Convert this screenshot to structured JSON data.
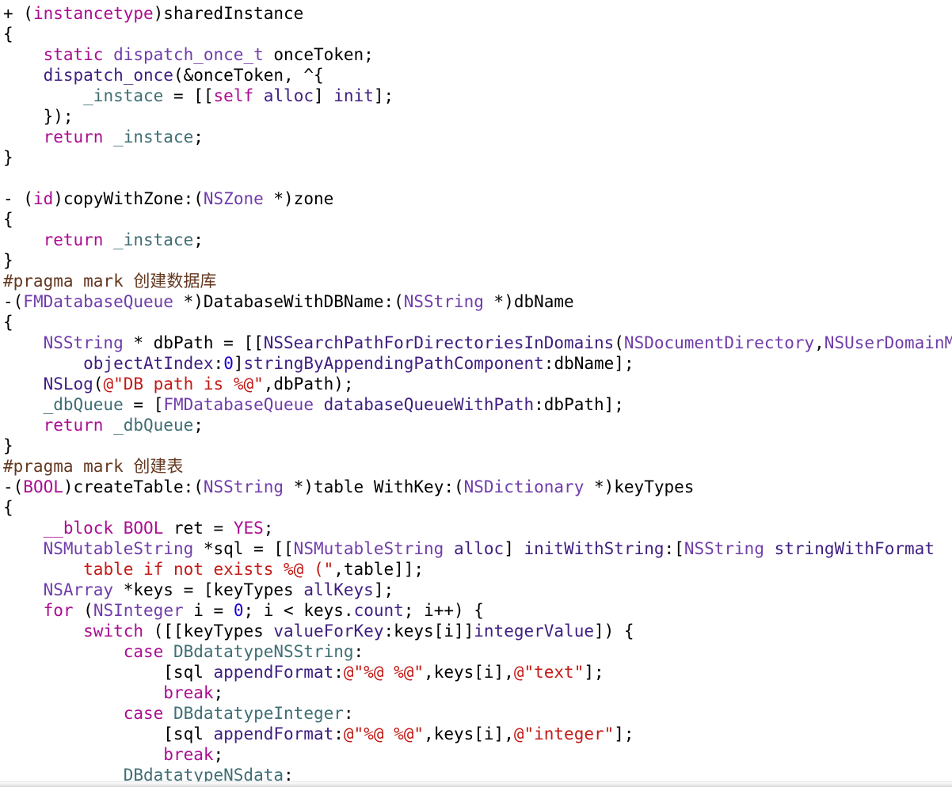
{
  "editor": {
    "lines": [
      [
        [
          "plain",
          "+ ("
        ],
        [
          "kw",
          "instancetype"
        ],
        [
          "plain",
          ")sharedInstance"
        ]
      ],
      [
        [
          "plain",
          "{"
        ]
      ],
      [
        [
          "plain",
          "    "
        ],
        [
          "kw",
          "static"
        ],
        [
          "plain",
          " "
        ],
        [
          "type",
          "dispatch_once_t"
        ],
        [
          "plain",
          " onceToken;"
        ]
      ],
      [
        [
          "plain",
          "    "
        ],
        [
          "call",
          "dispatch_once"
        ],
        [
          "plain",
          "(&onceToken, ^{"
        ]
      ],
      [
        [
          "plain",
          "        "
        ],
        [
          "var",
          "_instace"
        ],
        [
          "plain",
          " = [["
        ],
        [
          "kw",
          "self"
        ],
        [
          "plain",
          " "
        ],
        [
          "call",
          "alloc"
        ],
        [
          "plain",
          "] "
        ],
        [
          "call",
          "init"
        ],
        [
          "plain",
          "];"
        ]
      ],
      [
        [
          "plain",
          "    });"
        ]
      ],
      [
        [
          "plain",
          "    "
        ],
        [
          "kw",
          "return"
        ],
        [
          "plain",
          " "
        ],
        [
          "var",
          "_instace"
        ],
        [
          "plain",
          ";"
        ]
      ],
      [
        [
          "plain",
          "}"
        ]
      ],
      [],
      [
        [
          "plain",
          "- ("
        ],
        [
          "kw",
          "id"
        ],
        [
          "plain",
          ")copyWithZone:("
        ],
        [
          "type",
          "NSZone"
        ],
        [
          "plain",
          " *)zone"
        ]
      ],
      [
        [
          "plain",
          "{"
        ]
      ],
      [
        [
          "plain",
          "    "
        ],
        [
          "kw",
          "return"
        ],
        [
          "plain",
          " "
        ],
        [
          "var",
          "_instace"
        ],
        [
          "plain",
          ";"
        ]
      ],
      [
        [
          "plain",
          "}"
        ]
      ],
      [
        [
          "pre",
          "#pragma mark 创建数据库"
        ]
      ],
      [
        [
          "plain",
          "-("
        ],
        [
          "type",
          "FMDatabaseQueue"
        ],
        [
          "plain",
          " *)DatabaseWithDBName:("
        ],
        [
          "type",
          "NSString"
        ],
        [
          "plain",
          " *)dbName"
        ]
      ],
      [
        [
          "plain",
          "{"
        ]
      ],
      [
        [
          "plain",
          "    "
        ],
        [
          "type",
          "NSString"
        ],
        [
          "plain",
          " * dbPath = [["
        ],
        [
          "call",
          "NSSearchPathForDirectoriesInDomains"
        ],
        [
          "plain",
          "("
        ],
        [
          "type",
          "NSDocumentDirectory"
        ],
        [
          "plain",
          ","
        ],
        [
          "type",
          "NSUserDomainMask"
        ]
      ],
      [
        [
          "plain",
          "        "
        ],
        [
          "call",
          "objectAtIndex"
        ],
        [
          "plain",
          ":"
        ],
        [
          "num",
          "0"
        ],
        [
          "plain",
          "]"
        ],
        [
          "call",
          "stringByAppendingPathComponent"
        ],
        [
          "plain",
          ":dbName];"
        ]
      ],
      [
        [
          "plain",
          "    "
        ],
        [
          "call",
          "NSLog"
        ],
        [
          "plain",
          "("
        ],
        [
          "str",
          "@\"DB path is %@\""
        ],
        [
          "plain",
          ",dbPath);"
        ]
      ],
      [
        [
          "plain",
          "    "
        ],
        [
          "var",
          "_dbQueue"
        ],
        [
          "plain",
          " = ["
        ],
        [
          "type",
          "FMDatabaseQueue"
        ],
        [
          "plain",
          " "
        ],
        [
          "call",
          "databaseQueueWithPath"
        ],
        [
          "plain",
          ":dbPath];"
        ]
      ],
      [
        [
          "plain",
          "    "
        ],
        [
          "kw",
          "return"
        ],
        [
          "plain",
          " "
        ],
        [
          "var",
          "_dbQueue"
        ],
        [
          "plain",
          ";"
        ]
      ],
      [
        [
          "plain",
          "}"
        ]
      ],
      [
        [
          "pre",
          "#pragma mark 创建表"
        ]
      ],
      [
        [
          "plain",
          "-("
        ],
        [
          "kw",
          "BOOL"
        ],
        [
          "plain",
          ")createTable:("
        ],
        [
          "type",
          "NSString"
        ],
        [
          "plain",
          " *)table WithKey:("
        ],
        [
          "type",
          "NSDictionary"
        ],
        [
          "plain",
          " *)keyTypes"
        ]
      ],
      [
        [
          "plain",
          "{"
        ]
      ],
      [
        [
          "plain",
          "    "
        ],
        [
          "kw",
          "__block"
        ],
        [
          "plain",
          " "
        ],
        [
          "kw",
          "BOOL"
        ],
        [
          "plain",
          " ret = "
        ],
        [
          "kw",
          "YES"
        ],
        [
          "plain",
          ";"
        ]
      ],
      [
        [
          "plain",
          "    "
        ],
        [
          "type",
          "NSMutableString"
        ],
        [
          "plain",
          " *sql = [["
        ],
        [
          "type",
          "NSMutableString"
        ],
        [
          "plain",
          " "
        ],
        [
          "call",
          "alloc"
        ],
        [
          "plain",
          "] "
        ],
        [
          "call",
          "initWithString"
        ],
        [
          "plain",
          ":["
        ],
        [
          "type",
          "NSString"
        ],
        [
          "plain",
          " "
        ],
        [
          "call",
          "stringWithFormat"
        ]
      ],
      [
        [
          "plain",
          "        "
        ],
        [
          "str",
          "table if not exists %@ (\""
        ],
        [
          "plain",
          ",table]];"
        ]
      ],
      [
        [
          "plain",
          "    "
        ],
        [
          "type",
          "NSArray"
        ],
        [
          "plain",
          " *keys = [keyTypes "
        ],
        [
          "call",
          "allKeys"
        ],
        [
          "plain",
          "];"
        ]
      ],
      [
        [
          "plain",
          "    "
        ],
        [
          "kw",
          "for"
        ],
        [
          "plain",
          " ("
        ],
        [
          "type",
          "NSInteger"
        ],
        [
          "plain",
          " i = "
        ],
        [
          "num",
          "0"
        ],
        [
          "plain",
          "; i < keys."
        ],
        [
          "call",
          "count"
        ],
        [
          "plain",
          "; i++) {"
        ]
      ],
      [
        [
          "plain",
          "        "
        ],
        [
          "kw",
          "switch"
        ],
        [
          "plain",
          " ([[keyTypes "
        ],
        [
          "call",
          "valueForKey"
        ],
        [
          "plain",
          ":keys[i]]"
        ],
        [
          "call",
          "integerValue"
        ],
        [
          "plain",
          "]) {"
        ]
      ],
      [
        [
          "plain",
          "            "
        ],
        [
          "kw",
          "case"
        ],
        [
          "plain",
          " "
        ],
        [
          "var",
          "DBdatatypeNSString"
        ],
        [
          "plain",
          ":"
        ]
      ],
      [
        [
          "plain",
          "                [sql "
        ],
        [
          "call",
          "appendFormat"
        ],
        [
          "plain",
          ":"
        ],
        [
          "str",
          "@\"%@ %@\""
        ],
        [
          "plain",
          ",keys[i],"
        ],
        [
          "str",
          "@\"text\""
        ],
        [
          "plain",
          "];"
        ]
      ],
      [
        [
          "plain",
          "                "
        ],
        [
          "kw",
          "break"
        ],
        [
          "plain",
          ";"
        ]
      ],
      [
        [
          "plain",
          "            "
        ],
        [
          "kw",
          "case"
        ],
        [
          "plain",
          " "
        ],
        [
          "var",
          "DBdatatypeInteger"
        ],
        [
          "plain",
          ":"
        ]
      ],
      [
        [
          "plain",
          "                [sql "
        ],
        [
          "call",
          "appendFormat"
        ],
        [
          "plain",
          ":"
        ],
        [
          "str",
          "@\"%@ %@\""
        ],
        [
          "plain",
          ",keys[i],"
        ],
        [
          "str",
          "@\"integer\""
        ],
        [
          "plain",
          "];"
        ]
      ],
      [
        [
          "plain",
          "                "
        ],
        [
          "kw",
          "break"
        ],
        [
          "plain",
          ";"
        ]
      ],
      [
        [
          "plain",
          "            "
        ],
        [
          "var",
          "DBdatatypeNSdata"
        ],
        [
          "plain",
          ":"
        ]
      ]
    ]
  },
  "colors": {
    "keyword": "#aa0d91",
    "type": "#703daa",
    "call": "#3e1e81",
    "variable": "#3f6e74",
    "string": "#c41a16",
    "number": "#1c00cf",
    "preprocessor": "#643820",
    "plain": "#000000",
    "background": "#ffffff"
  }
}
